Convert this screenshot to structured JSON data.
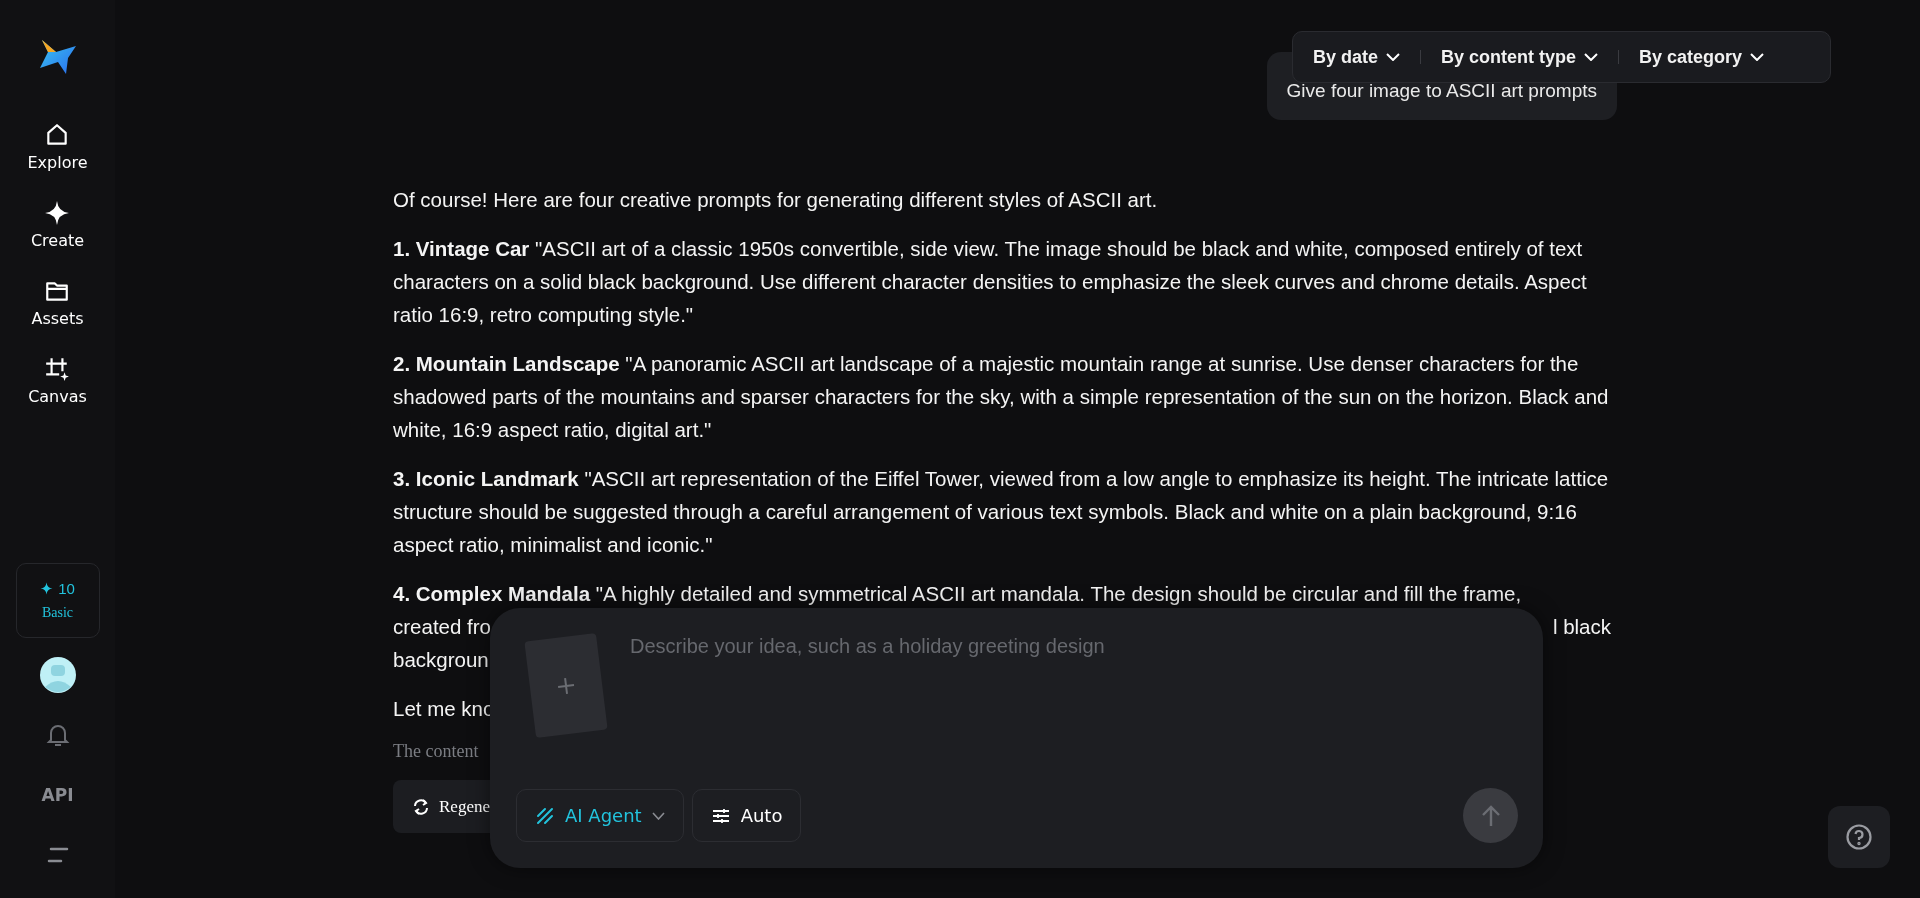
{
  "sidebar": {
    "nav": [
      {
        "label": "Explore",
        "kind": "home"
      },
      {
        "label": "Create",
        "kind": "sparkle"
      },
      {
        "label": "Assets",
        "kind": "folder"
      },
      {
        "label": "Canvas",
        "kind": "canvas"
      }
    ],
    "credits": {
      "count": "10",
      "plan": "Basic"
    },
    "api_label": "API"
  },
  "filters": [
    "By date",
    "By content type",
    "By category"
  ],
  "user_message": "Give four image to ASCII art prompts",
  "response": {
    "intro": "Of course! Here are four creative prompts for generating different styles of ASCII art.",
    "items": [
      "**1. Vintage Car** \"ASCII art of a classic 1950s convertible, side view. The image should be black and white, composed entirely of text characters on a solid black background. Use different character densities to emphasize the sleek curves and chrome details. Aspect ratio 16:9, retro computing style.\"",
      "**2. Mountain Landscape** \"A panoramic ASCII art landscape of a majestic mountain range at sunrise. Use denser characters for the shadowed parts of the mountains and sparser characters for the sky, with a simple representation of the sun on the horizon. Black and white, 16:9 aspect ratio, digital art.\"",
      "**3. Iconic Landmark** \"ASCII art representation of the Eiffel Tower, viewed from a low angle to emphasize its height. The intricate lattice structure should be suggested through a careful arrangement of various text symbols. Black and white on a plain background, 9:16 aspect ratio, minimalist and iconic.\""
    ],
    "partial_item": [
      {
        "left": "**4. Complex Mandala** \"A highly detailed and symmetrical ASCII art mandala. The design should be circular and fill the frame,"
      },
      {
        "left": "created fro",
        "right": "l black"
      },
      {
        "left": "backgroun"
      }
    ],
    "closing": "Let me kno",
    "disclaimer": "The content",
    "regenerate": "Regene"
  },
  "composer": {
    "placeholder": "Describe your idea, such as a holiday greeting design",
    "buttons": [
      {
        "label": "AI Agent",
        "kind": "agent"
      },
      {
        "label": "Auto",
        "kind": "settings"
      }
    ],
    "send_disabled": true
  }
}
